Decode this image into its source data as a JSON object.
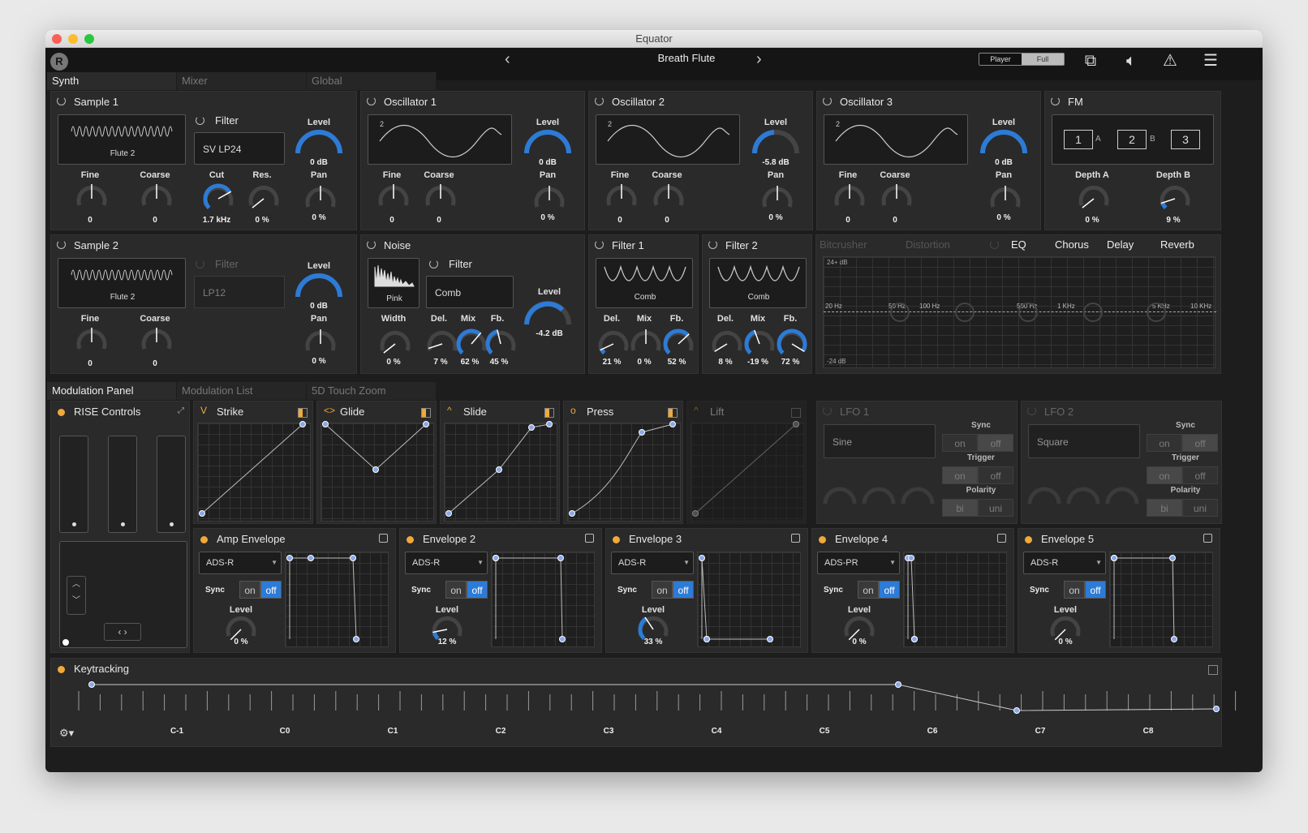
{
  "window": {
    "title": "Equator"
  },
  "header": {
    "preset": "Breath Flute",
    "player": "Player",
    "full": "Full"
  },
  "tabs": {
    "top": [
      "Synth",
      "Mixer",
      "Global"
    ],
    "mod": [
      "Modulation Panel",
      "Modulation List",
      "5D Touch Zoom"
    ]
  },
  "sample1": {
    "title": "Sample 1",
    "wave": "Flute 2",
    "filter": "Filter",
    "filter_type": "SV LP24",
    "level": "Level",
    "level_val": "0 dB",
    "fine": "Fine",
    "coarse": "Coarse",
    "fine_val": "0",
    "coarse_val": "0",
    "cut": "Cut",
    "cut_val": "1.7 kHz",
    "res": "Res.",
    "res_val": "0 %",
    "pan": "Pan",
    "pan_val": "0 %"
  },
  "osc1": {
    "title": "Oscillator 1",
    "num": "2",
    "level": "Level",
    "level_val": "0 dB",
    "fine": "Fine",
    "coarse": "Coarse",
    "fine_val": "0",
    "coarse_val": "0",
    "pan": "Pan",
    "pan_val": "0 %"
  },
  "osc2": {
    "title": "Oscillator 2",
    "num": "2",
    "level": "Level",
    "level_val": "-5.8 dB",
    "fine": "Fine",
    "coarse": "Coarse",
    "fine_val": "0",
    "coarse_val": "0",
    "pan": "Pan",
    "pan_val": "0 %"
  },
  "osc3": {
    "title": "Oscillator 3",
    "num": "2",
    "level": "Level",
    "level_val": "0 dB",
    "fine": "Fine",
    "coarse": "Coarse",
    "fine_val": "0",
    "coarse_val": "0",
    "pan": "Pan",
    "pan_val": "0 %"
  },
  "fm": {
    "title": "FM",
    "n1": "1",
    "n2": "2",
    "n3": "3",
    "a": "A",
    "b": "B",
    "depth_a": "Depth A",
    "depth_b": "Depth B",
    "depth_a_val": "0 %",
    "depth_b_val": "9 %"
  },
  "sample2": {
    "title": "Sample 2",
    "wave": "Flute 2",
    "filter": "Filter",
    "filter_type": "LP12",
    "level": "Level",
    "level_val": "0 dB",
    "fine": "Fine",
    "coarse": "Coarse",
    "fine_val": "0",
    "coarse_val": "0",
    "pan": "Pan",
    "pan_val": "0 %"
  },
  "noise": {
    "title": "Noise",
    "type": "Pink",
    "filter": "Filter",
    "filter_type": "Comb",
    "level": "Level",
    "level_val": "-4.2 dB",
    "width": "Width",
    "width_val": "0 %",
    "del": "Del.",
    "del_val": "7 %",
    "mix": "Mix",
    "mix_val": "62 %",
    "fb": "Fb.",
    "fb_val": "45 %"
  },
  "filter1": {
    "title": "Filter 1",
    "type": "Comb",
    "del": "Del.",
    "mix": "Mix",
    "fb": "Fb.",
    "del_val": "21 %",
    "mix_val": "0 %",
    "fb_val": "52 %"
  },
  "filter2": {
    "title": "Filter 2",
    "type": "Comb",
    "del": "Del.",
    "mix": "Mix",
    "fb": "Fb.",
    "del_val": "8 %",
    "mix_val": "-19 %",
    "fb_val": "72 %"
  },
  "fx": {
    "tabs": [
      "Bitcrusher",
      "Distortion",
      "EQ",
      "Chorus",
      "Delay",
      "Reverb"
    ],
    "db_top": "24+ dB",
    "db_bot": "-24 dB",
    "freqs": [
      "20 Hz",
      "50 Hz",
      "100 Hz",
      "500 Hz",
      "1 KHz",
      "5 KHz",
      "10 KHz"
    ]
  },
  "rise": {
    "title": "RISE Controls"
  },
  "dims": [
    {
      "title": "Strike",
      "icon": "V"
    },
    {
      "title": "Glide",
      "icon": "<>"
    },
    {
      "title": "Slide",
      "icon": "^"
    },
    {
      "title": "Press",
      "icon": "o"
    },
    {
      "title": "Lift",
      "icon": "^"
    }
  ],
  "lfo1": {
    "title": "LFO 1",
    "wave": "Sine",
    "sync": "Sync",
    "trigger": "Trigger",
    "polarity": "Polarity",
    "on": "on",
    "off": "off",
    "bi": "bi",
    "uni": "uni"
  },
  "lfo2": {
    "title": "LFO 2",
    "wave": "Square",
    "sync": "Sync",
    "trigger": "Trigger",
    "polarity": "Polarity",
    "on": "on",
    "off": "off",
    "bi": "bi",
    "uni": "uni"
  },
  "envs": [
    {
      "title": "Amp Envelope",
      "mode": "ADS-R",
      "sync": "Sync",
      "level": "Level",
      "level_val": "0 %"
    },
    {
      "title": "Envelope 2",
      "mode": "ADS-R",
      "sync": "Sync",
      "level": "Level",
      "level_val": "12 %"
    },
    {
      "title": "Envelope 3",
      "mode": "ADS-R",
      "sync": "Sync",
      "level": "Level",
      "level_val": "33 %"
    },
    {
      "title": "Envelope 4",
      "mode": "ADS-PR",
      "sync": "Sync",
      "level": "Level",
      "level_val": "0 %"
    },
    {
      "title": "Envelope 5",
      "mode": "ADS-R",
      "sync": "Sync",
      "level": "Level",
      "level_val": "0 %"
    }
  ],
  "seg": {
    "on": "on",
    "off": "off"
  },
  "keytracking": {
    "title": "Keytracking",
    "notes": [
      "C-1",
      "C0",
      "C1",
      "C2",
      "C3",
      "C4",
      "C5",
      "C6",
      "C7",
      "C8"
    ]
  },
  "colors": {
    "accent": "#2d7bd6",
    "dot": "#f0a93a",
    "bg": "#1d1d1d",
    "panel": "#2a2a2a"
  }
}
